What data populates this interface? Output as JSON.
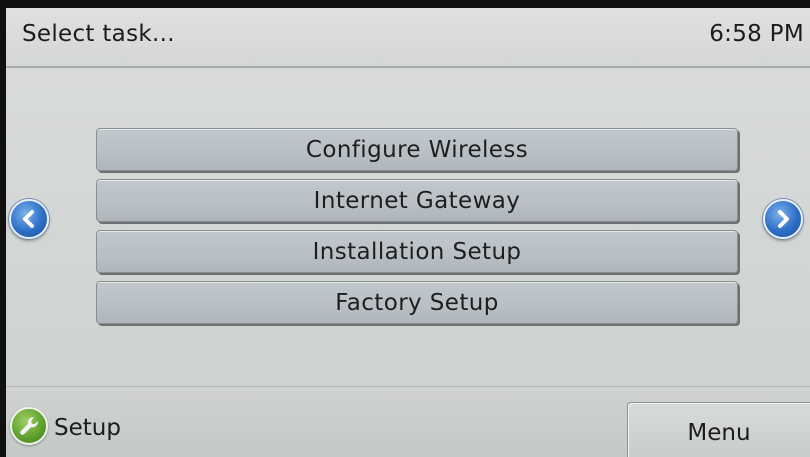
{
  "header": {
    "title": "Select task...",
    "time": "6:58 PM"
  },
  "tasks": [
    {
      "label": "Configure Wireless"
    },
    {
      "label": "Internet Gateway"
    },
    {
      "label": "Installation Setup"
    },
    {
      "label": "Factory Setup"
    }
  ],
  "nav": {
    "prev_icon": "chevron-left-icon",
    "next_icon": "chevron-right-icon"
  },
  "footer": {
    "setup_icon": "wrench-icon",
    "setup_label": "Setup",
    "menu_label": "Menu"
  },
  "colors": {
    "screen_bg": "#d4d7d6",
    "button_bg": "#b8bfc5",
    "nav_blue": "#2d6fc7",
    "setup_green": "#5c9e2b"
  }
}
